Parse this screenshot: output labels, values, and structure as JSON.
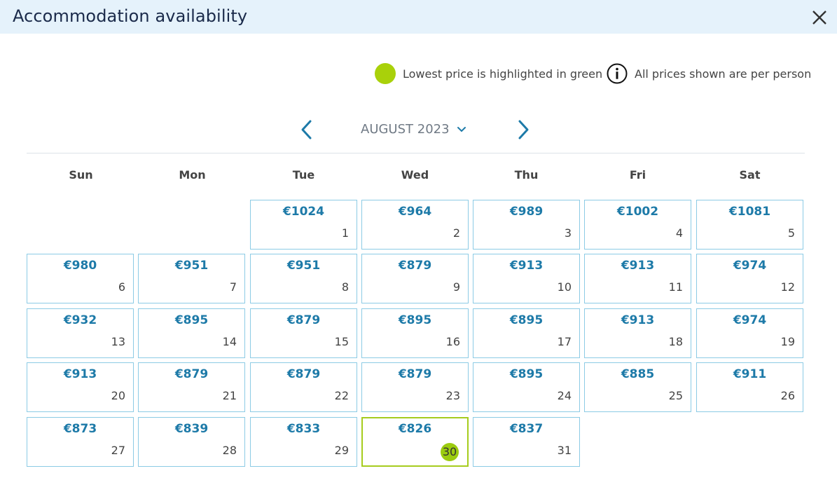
{
  "header": {
    "title": "Accommodation availability",
    "close_icon": "close-icon"
  },
  "legend": {
    "lowest_text": "Lowest price is highlighted in green",
    "lowest_color": "#a9d10a",
    "info_text": "All prices shown are per person",
    "info_icon": "info-icon"
  },
  "nav": {
    "month_label": "AUGUST 2023",
    "prev_icon": "chevron-left-icon",
    "next_icon": "chevron-right-icon",
    "dropdown_icon": "chevron-down-icon"
  },
  "weekdays": [
    "Sun",
    "Mon",
    "Tue",
    "Wed",
    "Thu",
    "Fri",
    "Sat"
  ],
  "colors": {
    "accent": "#1d7aa8",
    "cell_border": "#8ccbe5",
    "lowest": "#9ccc10",
    "header_bg": "#e5f2fb"
  },
  "calendar": {
    "days": [
      {
        "day": "1",
        "price": "€1024"
      },
      {
        "day": "2",
        "price": "€964"
      },
      {
        "day": "3",
        "price": "€989"
      },
      {
        "day": "4",
        "price": "€1002"
      },
      {
        "day": "5",
        "price": "€1081"
      },
      {
        "day": "6",
        "price": "€980"
      },
      {
        "day": "7",
        "price": "€951"
      },
      {
        "day": "8",
        "price": "€951"
      },
      {
        "day": "9",
        "price": "€879"
      },
      {
        "day": "10",
        "price": "€913"
      },
      {
        "day": "11",
        "price": "€913"
      },
      {
        "day": "12",
        "price": "€974"
      },
      {
        "day": "13",
        "price": "€932"
      },
      {
        "day": "14",
        "price": "€895"
      },
      {
        "day": "15",
        "price": "€879"
      },
      {
        "day": "16",
        "price": "€895"
      },
      {
        "day": "17",
        "price": "€895"
      },
      {
        "day": "18",
        "price": "€913"
      },
      {
        "day": "19",
        "price": "€974"
      },
      {
        "day": "20",
        "price": "€913"
      },
      {
        "day": "21",
        "price": "€879"
      },
      {
        "day": "22",
        "price": "€879"
      },
      {
        "day": "23",
        "price": "€879"
      },
      {
        "day": "24",
        "price": "€895"
      },
      {
        "day": "25",
        "price": "€885"
      },
      {
        "day": "26",
        "price": "€911"
      },
      {
        "day": "27",
        "price": "€873"
      },
      {
        "day": "28",
        "price": "€839"
      },
      {
        "day": "29",
        "price": "€833"
      },
      {
        "day": "30",
        "price": "€826"
      },
      {
        "day": "31",
        "price": "€837"
      }
    ]
  }
}
